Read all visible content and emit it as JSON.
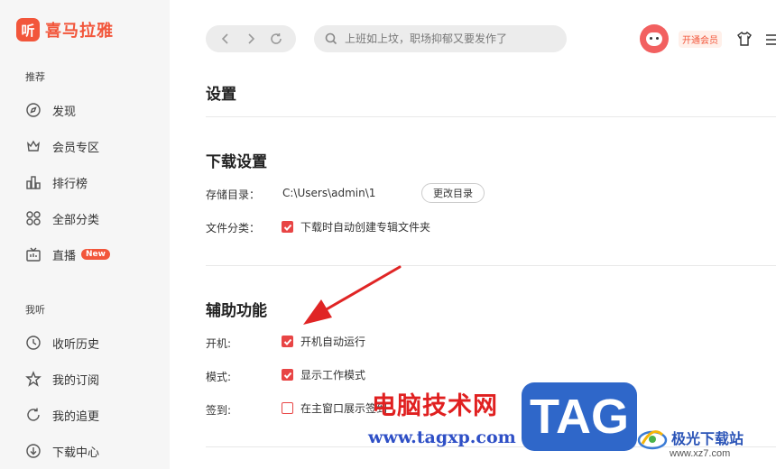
{
  "app": {
    "logo_mark": "听",
    "logo_text": "喜马拉雅"
  },
  "sidebar": {
    "section_recommend": "推荐",
    "recommend_items": [
      {
        "label": "发现",
        "icon": "compass-icon"
      },
      {
        "label": "会员专区",
        "icon": "crown-icon"
      },
      {
        "label": "排行榜",
        "icon": "chart-icon"
      },
      {
        "label": "全部分类",
        "icon": "grid-icon"
      },
      {
        "label": "直播",
        "icon": "tv-icon",
        "badge": "New"
      }
    ],
    "section_mine": "我听",
    "mine_items": [
      {
        "label": "收听历史",
        "icon": "clock-icon"
      },
      {
        "label": "我的订阅",
        "icon": "star-icon"
      },
      {
        "label": "我的追更",
        "icon": "refresh-icon"
      },
      {
        "label": "下载中心",
        "icon": "download-icon"
      }
    ]
  },
  "topbar": {
    "search_placeholder": "上班如上坟，职场抑郁又要发作了",
    "vip_label": "开通会员"
  },
  "settings": {
    "title": "设置",
    "download": {
      "title": "下载设置",
      "storage_label": "存储目录：",
      "storage_path": "C:\\Users\\admin\\1",
      "change_button": "更改目录",
      "category_label": "文件分类：",
      "category_option": "下载时自动创建专辑文件夹"
    },
    "assist": {
      "title": "辅助功能",
      "startup_label": "开机:",
      "startup_option": "开机自动运行",
      "mode_label": "模式:",
      "mode_option": "显示工作模式",
      "signin_label": "签到:",
      "signin_option": "在主窗口展示签到"
    }
  },
  "watermark": {
    "cn": "电脑技术网",
    "url": "www.tagxp.com",
    "tag": "TAG",
    "site_name": "极光下载站",
    "site_url": "www.xz7.com"
  },
  "colors": {
    "brand": "#f2563b",
    "checkbox": "#e84545",
    "watermark_blue": "#2f67c9"
  }
}
